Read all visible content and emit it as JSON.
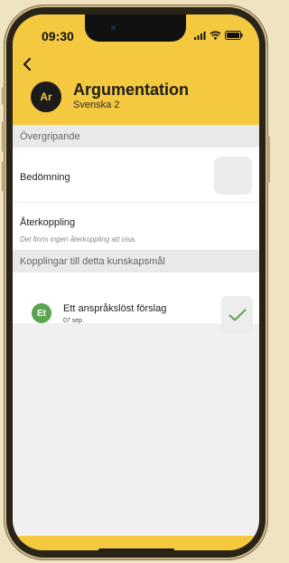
{
  "status_bar": {
    "time": "09:30"
  },
  "header": {
    "avatar_initials": "Ar",
    "title": "Argumentation",
    "subtitle": "Svenska 2"
  },
  "sections": {
    "overview": "Övergripande",
    "links": "Kopplingar till detta kunskapsmål"
  },
  "assessment": {
    "label": "Bedömning"
  },
  "feedback": {
    "label": "Återkoppling",
    "note": "Det finns ingen återkoppling att visa."
  },
  "linked_items": [
    {
      "initials": "Et",
      "title": "Ett anspråkslöst förslag",
      "date": "07 sep"
    }
  ],
  "colors": {
    "accent": "#f4c93f",
    "avatar_dark": "#1b1b1b",
    "item_avatar": "#5aa64f",
    "check": "#5aa64f",
    "background": "#efe3c2"
  },
  "icons": {
    "back": "chevron-left-icon",
    "signal": "signal-icon",
    "wifi": "wifi-icon",
    "battery": "battery-icon",
    "check": "checkmark-icon"
  }
}
